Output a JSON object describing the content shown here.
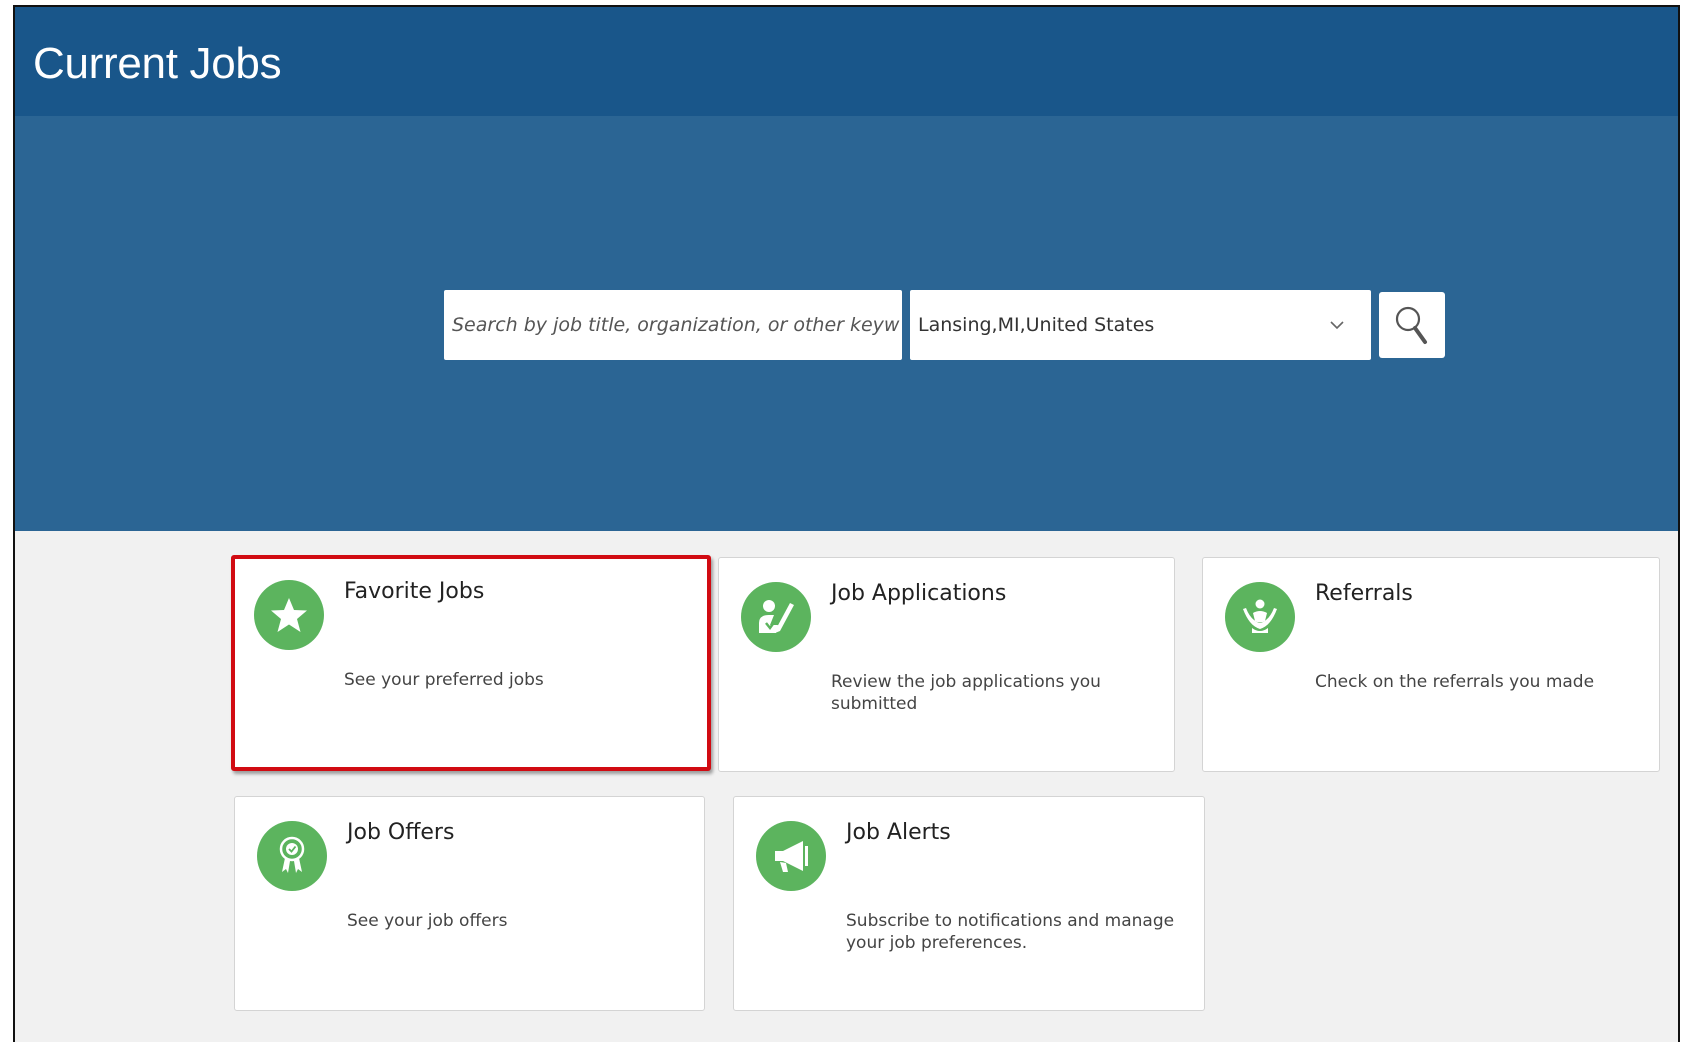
{
  "header": {
    "title": "Current Jobs",
    "background_color": "#19568a"
  },
  "hero": {
    "background_color": "#2b6594"
  },
  "search": {
    "placeholder": "Search by job title, organization, or other keyw",
    "location_value": "Lansing,MI,United States",
    "search_icon": "magnifier-icon",
    "dropdown_icon": "chevron-down-icon"
  },
  "tiles": [
    {
      "title": "Favorite Jobs",
      "description": "See your preferred jobs",
      "icon": "star-icon",
      "highlighted": true
    },
    {
      "title": "Job Applications",
      "description": "Review the job applications you submitted",
      "icon": "person-edit-icon",
      "highlighted": false
    },
    {
      "title": "Referrals",
      "description": "Check on the referrals you made",
      "icon": "hands-person-icon",
      "highlighted": false
    },
    {
      "title": "Job Offers",
      "description": "See your job offers",
      "icon": "award-ribbon-icon",
      "highlighted": false
    },
    {
      "title": "Job Alerts",
      "description": "Subscribe to notifications and manage your job preferences.",
      "icon": "megaphone-icon",
      "highlighted": false
    }
  ],
  "colors": {
    "icon_green": "#5cb45e",
    "highlight_red": "#d10b12"
  }
}
